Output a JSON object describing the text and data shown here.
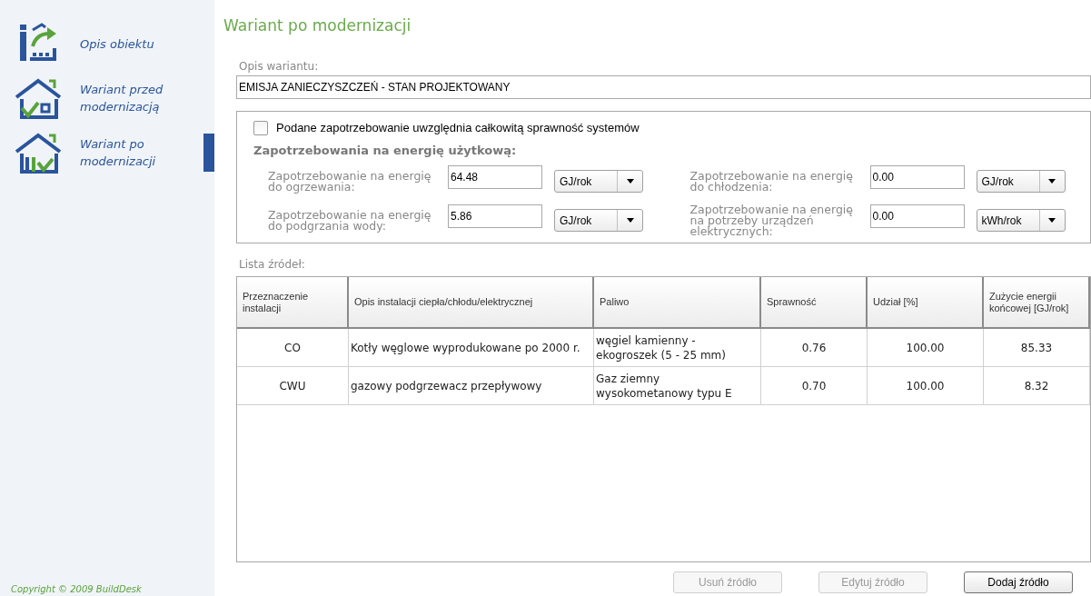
{
  "sidebar": {
    "items": [
      {
        "label": "Opis obiektu",
        "kind": "info",
        "selected": false
      },
      {
        "label": "Wariant przed modernizacją",
        "kind": "before",
        "selected": false
      },
      {
        "label": "Wariant po modernizacji",
        "kind": "after",
        "selected": true
      }
    ],
    "copyright": "Copyright © 2009 BuildDesk"
  },
  "title": "Wariant po modernizacji",
  "description": {
    "label": "Opis wariantu:",
    "value": "EMISJA ZANIECZYSZCZEŃ - STAN PROJEKTOWANY"
  },
  "demand": {
    "checkbox": {
      "label": "Podane zapotrzebowanie uwzględnia całkowitą sprawność systemów",
      "checked": false
    },
    "heading": "Zapotrzebowania na energię użytkową:",
    "fields": [
      {
        "label": "Zapotrzebowanie na energię do ogrzewania:",
        "value": "64.48",
        "unit": "GJ/rok"
      },
      {
        "label": "Zapotrzebowanie na energię do chłodzenia:",
        "value": "0.00",
        "unit": "GJ/rok"
      },
      {
        "label": "Zapotrzebowanie na energię do podgrzania wody:",
        "value": "5.86",
        "unit": "GJ/rok"
      },
      {
        "label": "Zapotrzebowanie na energię na potrzeby urządzeń elektrycznych:",
        "value": "0.00",
        "unit": "kWh/rok"
      }
    ]
  },
  "sources": {
    "label": "Lista źródeł:",
    "columns": [
      "Przeznaczenie instalacji",
      "Opis instalacji ciepła/chłodu/elektrycznej",
      "Paliwo",
      "Sprawność",
      "Udział [%]",
      "Zużycie energii końcowej [GJ/rok]"
    ],
    "rows": [
      {
        "cells": [
          "CO",
          "Kotły węglowe wyprodukowane po 2000 r.",
          "węgiel kamienny - ekogroszek (5 - 25 mm)",
          "0.76",
          "100.00",
          "85.33"
        ]
      },
      {
        "cells": [
          "CWU",
          "gazowy podgrzewacz przepływowy",
          "Gaz ziemny wysokometanowy typu E",
          "0.70",
          "100.00",
          "8.32"
        ]
      }
    ]
  },
  "buttons": [
    {
      "label": "Usuń źródło",
      "disabled": true
    },
    {
      "label": "Edytuj źródło",
      "disabled": true
    },
    {
      "label": "Dodaj źródło",
      "disabled": false
    }
  ]
}
